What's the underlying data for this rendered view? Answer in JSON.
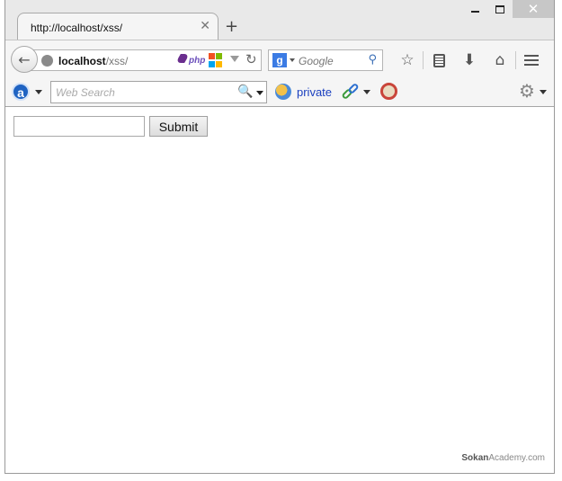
{
  "window": {
    "controls": {
      "close": "✕"
    }
  },
  "tab": {
    "title": "http://localhost/xss/",
    "close": "✕",
    "new_tab": "+"
  },
  "navbar": {
    "back": "←",
    "url_host": "localhost",
    "url_path": "/xss/",
    "php_label": "php",
    "reload": "↻",
    "search_engine_letter": "g",
    "search_placeholder": "Google",
    "search_glass": "⚲",
    "icons": [
      "star-icon",
      "reader-icon",
      "download-icon",
      "home-icon",
      "menu-icon"
    ],
    "star": "☆",
    "download": "⬇",
    "home": "⌂"
  },
  "addonbar": {
    "a_letter": "a",
    "websearch_placeholder": "Web Search",
    "websearch_glass": "🔍",
    "private_label": "private",
    "gear": "⚙"
  },
  "page": {
    "input_value": "",
    "submit_label": "Submit",
    "watermark_bold": "Sokan",
    "watermark_rest": "Academy.com"
  },
  "colors": {
    "titlebar": "#e9e9e9",
    "toolbar": "#f5f5f5",
    "link_blue": "#1a3fbf",
    "close_button": "#c7c7c7",
    "ms_red": "#f25022",
    "ms_green": "#7fba00",
    "ms_blue": "#00a4ef",
    "ms_yellow": "#ffb900"
  }
}
